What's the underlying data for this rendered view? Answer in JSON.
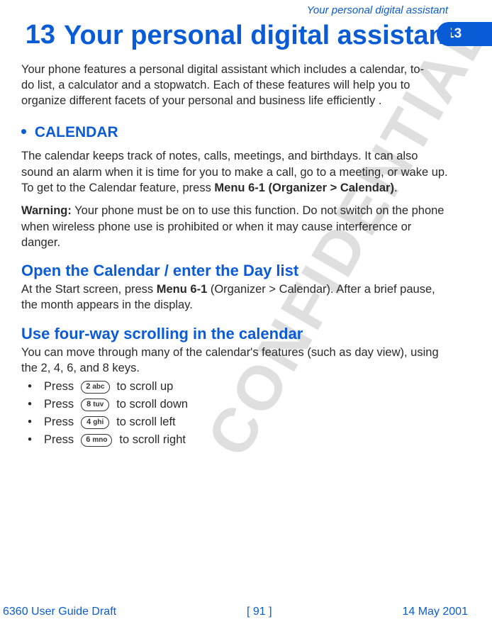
{
  "runningHead": "Your personal digital assistant",
  "chapter": {
    "number": "13",
    "title": "Your personal digital assistant"
  },
  "tab": "13",
  "watermark": "CONFIDENTIAL",
  "intro": "Your phone features a personal digital assistant which includes a calendar, to-do list, a calculator and a stopwatch. Each of these features will help you to organize different facets of your personal and business life efficiently .",
  "sectionCalendar": {
    "heading": "CALENDAR",
    "para1a": "The calendar keeps track of notes, calls, meetings, and birthdays. It can also sound an alarm when it is time for you to make a call, go to a meeting, or wake up. To get to the Calendar feature, press ",
    "para1b_bold": "Menu 6-1 (Organizer > Calendar)",
    "para1c": ".",
    "warnLabel": "Warning:",
    "warnText": " Your phone must be on to use this function. Do not switch on the phone when wireless phone use is prohibited or when it may cause interference or danger."
  },
  "subOpen": {
    "heading": "Open the Calendar / enter the Day list",
    "textA": "At the Start screen, press ",
    "textB_bold": "Menu 6-1",
    "textC": " (Organizer > Calendar). After a brief pause, the month appears in the display."
  },
  "subScroll": {
    "heading": "Use four-way scrolling in the calendar",
    "intro": "You can move through many of the calendar's features (such as day view), using the 2, 4, 6, and 8 keys.",
    "items": [
      {
        "pre": "Press ",
        "keyDigit": "2",
        "keyLetters": "abc",
        "post": " to scroll up"
      },
      {
        "pre": "Press ",
        "keyDigit": "8",
        "keyLetters": "tuv",
        "post": " to scroll down"
      },
      {
        "pre": "Press ",
        "keyDigit": "4",
        "keyLetters": "ghi",
        "post": " to scroll left"
      },
      {
        "pre": "Press ",
        "keyDigit": "6",
        "keyLetters": "mno",
        "post": " to scroll right"
      }
    ]
  },
  "footer": {
    "left": "6360 User Guide Draft",
    "center": "[ 91 ]",
    "right": "14 May 2001"
  }
}
